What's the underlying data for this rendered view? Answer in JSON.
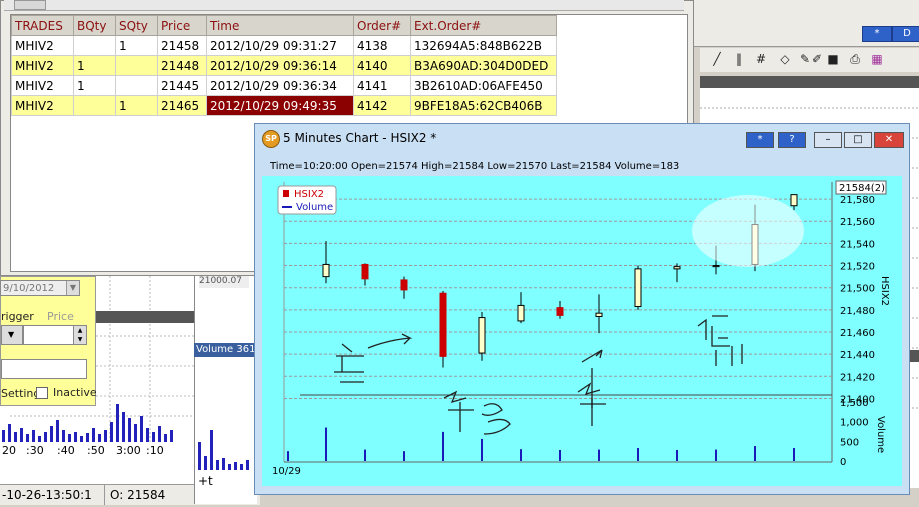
{
  "trades": {
    "columns": [
      "TRADES",
      "BQty",
      "SQty",
      "Price",
      "Time",
      "Order#",
      "Ext.Order#"
    ],
    "rows": [
      {
        "symbol": "MHIV2",
        "bqty": "",
        "sqty": "1",
        "price": "21458",
        "time": "2012/10/29 09:31:27",
        "order": "4138",
        "ext": "132694A5:848B622B"
      },
      {
        "symbol": "MHIV2",
        "bqty": "1",
        "sqty": "",
        "price": "21448",
        "time": "2012/10/29 09:36:14",
        "order": "4140",
        "ext": "B3A690AD:304D0DED"
      },
      {
        "symbol": "MHIV2",
        "bqty": "1",
        "sqty": "",
        "price": "21445",
        "time": "2012/10/29 09:36:34",
        "order": "4141",
        "ext": "3B2610AD:06AFE450"
      },
      {
        "symbol": "MHIV2",
        "bqty": "",
        "sqty": "1",
        "price": "21465",
        "time": "2012/10/29 09:49:35",
        "order": "4142",
        "ext": "9BFE18A5:62CB406B"
      }
    ]
  },
  "right_panel": {
    "btn_star": "*",
    "btn_d": "D"
  },
  "left_panel": {
    "date_value": "9/10/2012",
    "trigger_label": "rigger",
    "price_label": "Price",
    "setting_label": "Setting",
    "inactive_label": "Inactive",
    "time_labels": [
      "20",
      ":30",
      ":40",
      ":50",
      "3:00",
      ":10"
    ],
    "status_left": "-10-26-13:50:1",
    "status_right": "O: 21584"
  },
  "mid_panel": {
    "volume_label": "Volume 361",
    "axis_label": "+t",
    "top_value": "21000.07"
  },
  "chart": {
    "window_title": "5 Minutes Chart - HSIX2 *",
    "btn_star": "*",
    "btn_help": "?",
    "info_line": "Time=10:20:00 Open=21574 High=21584 Low=21570 Last=21584 Volume=183",
    "legend_series": "HSIX2",
    "legend_volume": "Volume",
    "axis_title_price": "HSIX2",
    "axis_title_volume": "Volume",
    "last_label": "21584(2)",
    "date_label": "10/29",
    "colors": {
      "background": "#7fffff",
      "up": "#ffffcc",
      "down": "#cc0000",
      "volume": "#1a1ab8",
      "legend_series": "#cc0000"
    }
  },
  "chart_data": {
    "type": "candlestick",
    "price_ticks": [
      "21,580",
      "21,560",
      "21,540",
      "21,520",
      "21,500",
      "21,480",
      "21,460",
      "21,440",
      "21,420",
      "21,400"
    ],
    "volume_ticks": [
      "1,500",
      "1,000",
      "500",
      "0"
    ],
    "ylim_price": [
      21395,
      21590
    ],
    "ylim_volume": [
      0,
      1600
    ],
    "candles": [
      {
        "o": 21510,
        "h": 21542,
        "l": 21504,
        "c": 21521,
        "v": 850
      },
      {
        "o": 21521,
        "h": 21522,
        "l": 21502,
        "c": 21508,
        "v": 290
      },
      {
        "o": 21507,
        "h": 21510,
        "l": 21490,
        "c": 21498,
        "v": 250
      },
      {
        "o": 21495,
        "h": 21497,
        "l": 21428,
        "c": 21438,
        "v": 740
      },
      {
        "o": 21441,
        "h": 21478,
        "l": 21434,
        "c": 21473,
        "v": 560
      },
      {
        "o": 21470,
        "h": 21496,
        "l": 21468,
        "c": 21484,
        "v": 300
      },
      {
        "o": 21482,
        "h": 21488,
        "l": 21472,
        "c": 21475,
        "v": 280
      },
      {
        "o": 21474,
        "h": 21494,
        "l": 21459,
        "c": 21477,
        "v": 290
      },
      {
        "o": 21483,
        "h": 21520,
        "l": 21480,
        "c": 21517,
        "v": 330
      },
      {
        "o": 21517,
        "h": 21522,
        "l": 21505,
        "c": 21519,
        "v": 280
      },
      {
        "o": 21519,
        "h": 21538,
        "l": 21512,
        "c": 21520,
        "v": 290
      },
      {
        "o": 21521,
        "h": 21575,
        "l": 21515,
        "c": 21557,
        "v": 380
      },
      {
        "o": 21574,
        "h": 21584,
        "l": 21570,
        "c": 21584,
        "v": 330
      }
    ],
    "last_price": 21584
  }
}
